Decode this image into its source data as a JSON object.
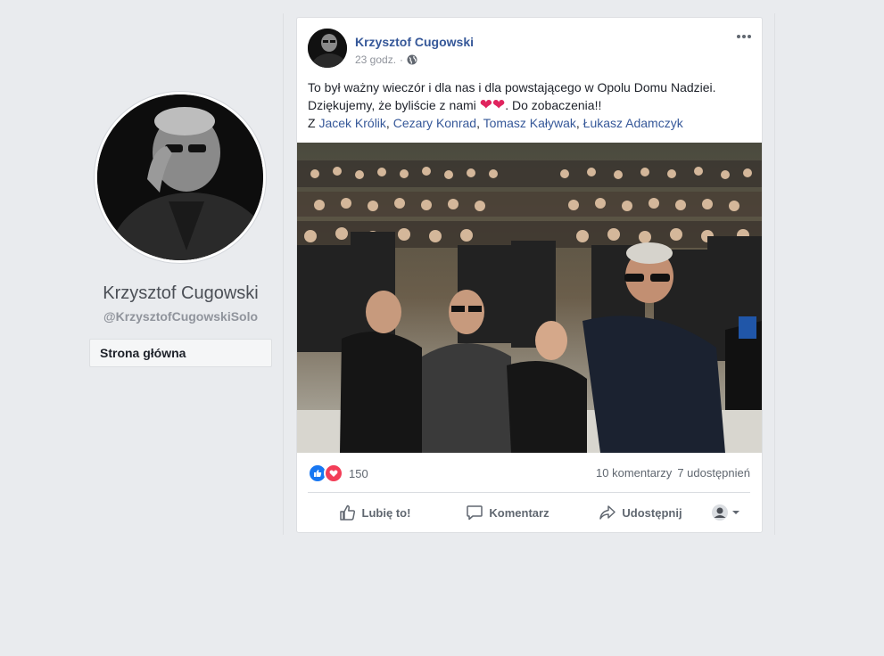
{
  "profile": {
    "name": "Krzysztof Cugowski",
    "handle": "@KrzysztofCugowskiSolo",
    "nav_home": "Strona główna"
  },
  "post": {
    "author": "Krzysztof Cugowski",
    "time": "23 godz.",
    "meta_sep": "·",
    "text_line1": "To był ważny wieczór i dla nas i dla powstającego w Opolu Domu Nadziei. Dziękujemy, że byliście z nami ",
    "text_line1_end": ". Do zobaczenia!!",
    "tag_prefix": "Z ",
    "tagged": [
      "Jacek Królik",
      "Cezary Konrad",
      "Tomasz Kaływak",
      "Łukasz Adamczyk"
    ],
    "tag_sep": ", ",
    "reaction_count": "150",
    "comments": "10 komentarzy",
    "shares": "7 udostępnień",
    "actions": {
      "like": "Lubię to!",
      "comment": "Komentarz",
      "share": "Udostępnij"
    }
  },
  "colors": {
    "background": "#e9ebee",
    "link": "#365899",
    "like_blue": "#1877f2",
    "love_red": "#f33e58"
  }
}
